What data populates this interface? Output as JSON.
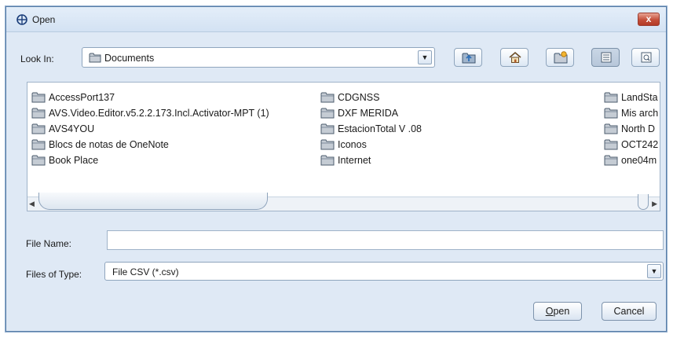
{
  "window": {
    "title": "Open",
    "close_label": "x"
  },
  "lookin": {
    "label": "Look In:",
    "value": "Documents"
  },
  "toolbar": {
    "buttons": [
      {
        "name": "up-one-level-button",
        "icon": "folder-up-icon"
      },
      {
        "name": "home-button",
        "icon": "home-icon"
      },
      {
        "name": "new-folder-button",
        "icon": "new-folder-icon"
      },
      {
        "name": "list-view-button",
        "icon": "list-view-icon",
        "active": true
      },
      {
        "name": "details-view-button",
        "icon": "details-view-icon"
      }
    ]
  },
  "files": {
    "col1": [
      "AccessPort137",
      "AVS.Video.Editor.v5.2.2.173.Incl.Activator-MPT (1)",
      "AVS4YOU",
      "Blocs de notas de OneNote",
      "Book Place"
    ],
    "col2": [
      "CDGNSS",
      "DXF MERIDA",
      "EstacionTotal V .08",
      "Iconos",
      "Internet"
    ],
    "col3": [
      "LandSta",
      "Mis arch",
      "North D",
      "OCT242",
      "one04m"
    ]
  },
  "file_name": {
    "label": "File Name:",
    "value": ""
  },
  "file_type": {
    "label": "Files of Type:",
    "value": "File CSV (*.csv)"
  },
  "buttons": {
    "open_mnemonic": "O",
    "open_rest": "pen",
    "cancel": "Cancel"
  },
  "colors": {
    "accent": "#5a7fa8",
    "window_bg": "#dfe9f5",
    "folder": "#5d6f82"
  }
}
